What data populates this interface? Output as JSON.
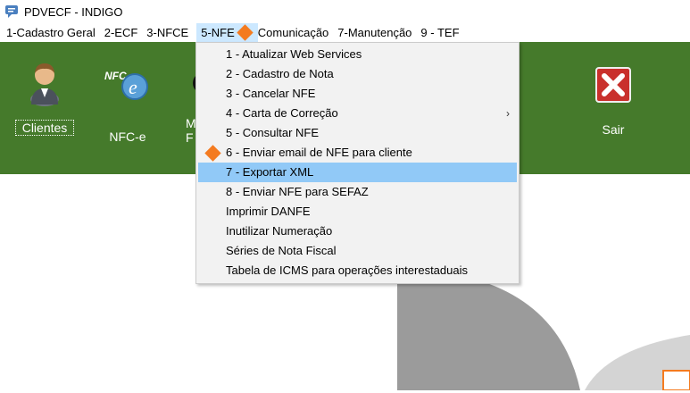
{
  "window": {
    "title": "PDVECF - INDIGO",
    "icon": "speech-bubble-app-icon"
  },
  "menubar": {
    "items": [
      {
        "label": "1-Cadastro Geral"
      },
      {
        "label": "2-ECF"
      },
      {
        "label": "3-NFCE"
      },
      {
        "label": "5-NFE"
      },
      {
        "label": "Comunicação"
      },
      {
        "label": "7-Manutenção"
      },
      {
        "label": "9 - TEF"
      }
    ]
  },
  "toolbar": {
    "clientes_label": "Clientes",
    "nfce_label": "NFC-e",
    "hidden_label_1": "M",
    "hidden_label_2": "F",
    "sair_label": "Sair"
  },
  "nfe_menu": {
    "items": [
      {
        "label": "1 - Atualizar Web Services"
      },
      {
        "label": "2 - Cadastro de Nota"
      },
      {
        "label": "3 - Cancelar NFE"
      },
      {
        "label": "4 - Carta de Correção",
        "submenu": true,
        "arrow": "›"
      },
      {
        "label": "5 - Consultar NFE"
      },
      {
        "label": "6 - Enviar email de NFE para cliente"
      },
      {
        "label": "7 - Exportar XML",
        "highlighted": true
      },
      {
        "label": "8 - Enviar NFE para SEFAZ"
      },
      {
        "label": "Imprimir DANFE"
      },
      {
        "label": "Inutilizar Numeração"
      },
      {
        "label": "Séries de Nota Fiscal"
      },
      {
        "label": "Tabela de ICMS para operações interestaduais"
      }
    ]
  },
  "colors": {
    "toolbar_bg": "#457a2b",
    "menu_active": "#cce8ff",
    "menu_highlight": "#91c9f7",
    "marker": "#f47b20"
  }
}
